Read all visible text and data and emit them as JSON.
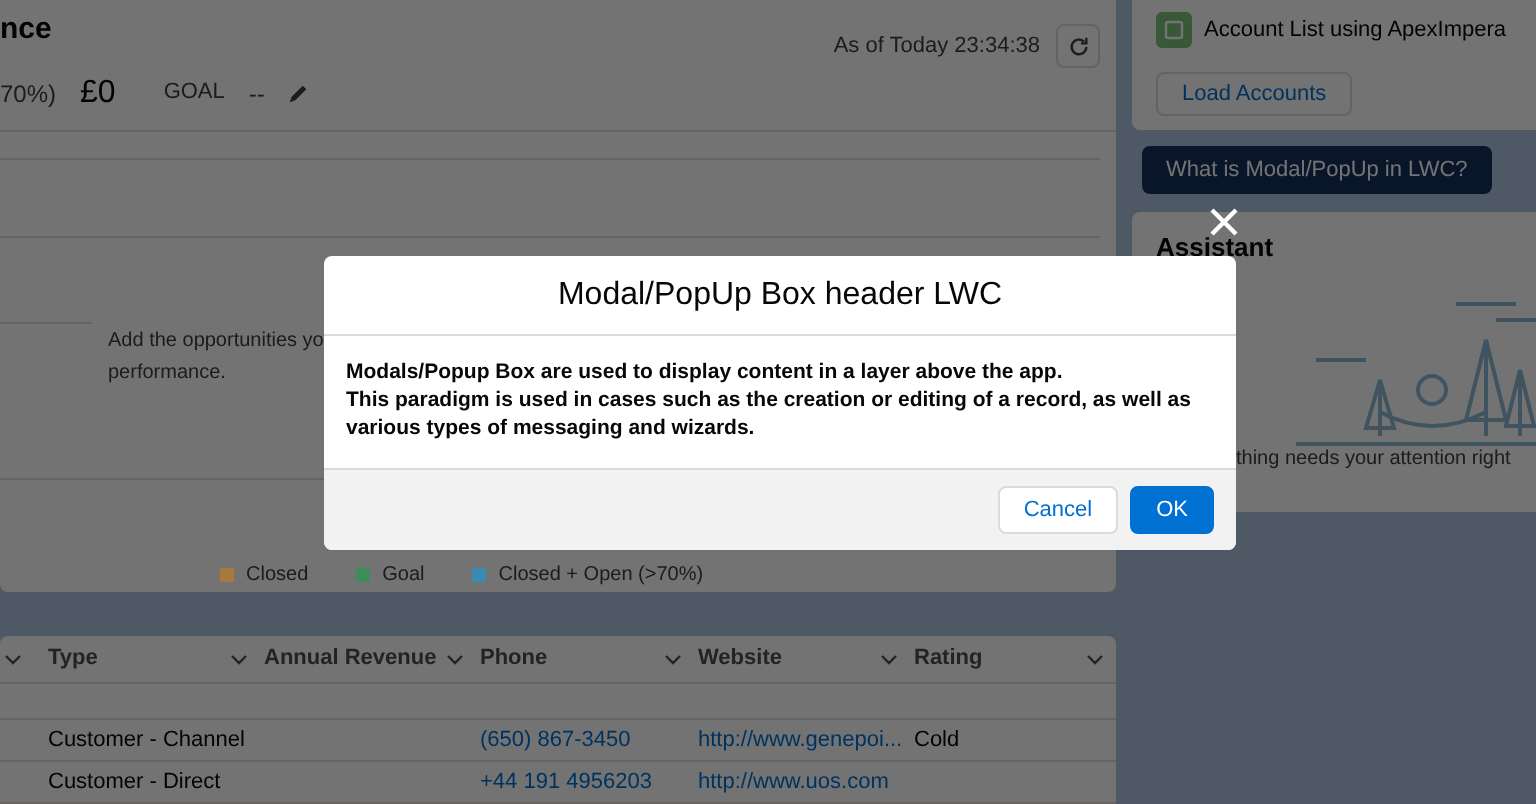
{
  "performance_card": {
    "title": "nce",
    "timestamp": "As of Today 23:34:38",
    "stats": [
      {
        "label": "70%)",
        "value": "£0"
      }
    ],
    "goal": {
      "label": "GOAL",
      "value": "--"
    },
    "empty_message": [
      "Add the opportunities yo",
      "performance."
    ],
    "legend": [
      {
        "label": "Closed",
        "color": "#a8793a"
      },
      {
        "label": "Goal",
        "color": "#3d8c5a"
      },
      {
        "label": "Closed + Open (>70%)",
        "color": "#3b8bb0"
      }
    ]
  },
  "table": {
    "columns": [
      "",
      "Type",
      "Annual Revenue",
      "Phone",
      "Website",
      "Rating"
    ],
    "rows": [
      [
        "",
        "",
        "",
        "",
        "",
        ""
      ],
      [
        "",
        "Customer - Channel",
        "",
        "(650) 867-3450",
        "http://www.genepoi...",
        "Cold"
      ],
      [
        "",
        "Customer - Direct",
        "",
        "+44 191 4956203",
        "http://www.uos.com",
        ""
      ]
    ]
  },
  "account_card": {
    "title": "Account List using ApexImpera",
    "button": "Load Accounts"
  },
  "modal_button": "What is Modal/PopUp in LWC?",
  "assistant": {
    "title": "Assistant",
    "message": "thing needs your attention right"
  },
  "modal": {
    "title": "Modal/PopUp Box header LWC",
    "body": [
      "Modals/Popup Box are used to display content in a layer above the app.",
      "This paradigm is used in cases such as the creation or editing of a record, as well as various types of messaging and wizards."
    ],
    "buttons": [
      {
        "label": "Cancel",
        "kind": "neutral"
      },
      {
        "label": "OK",
        "kind": "brand"
      }
    ]
  }
}
